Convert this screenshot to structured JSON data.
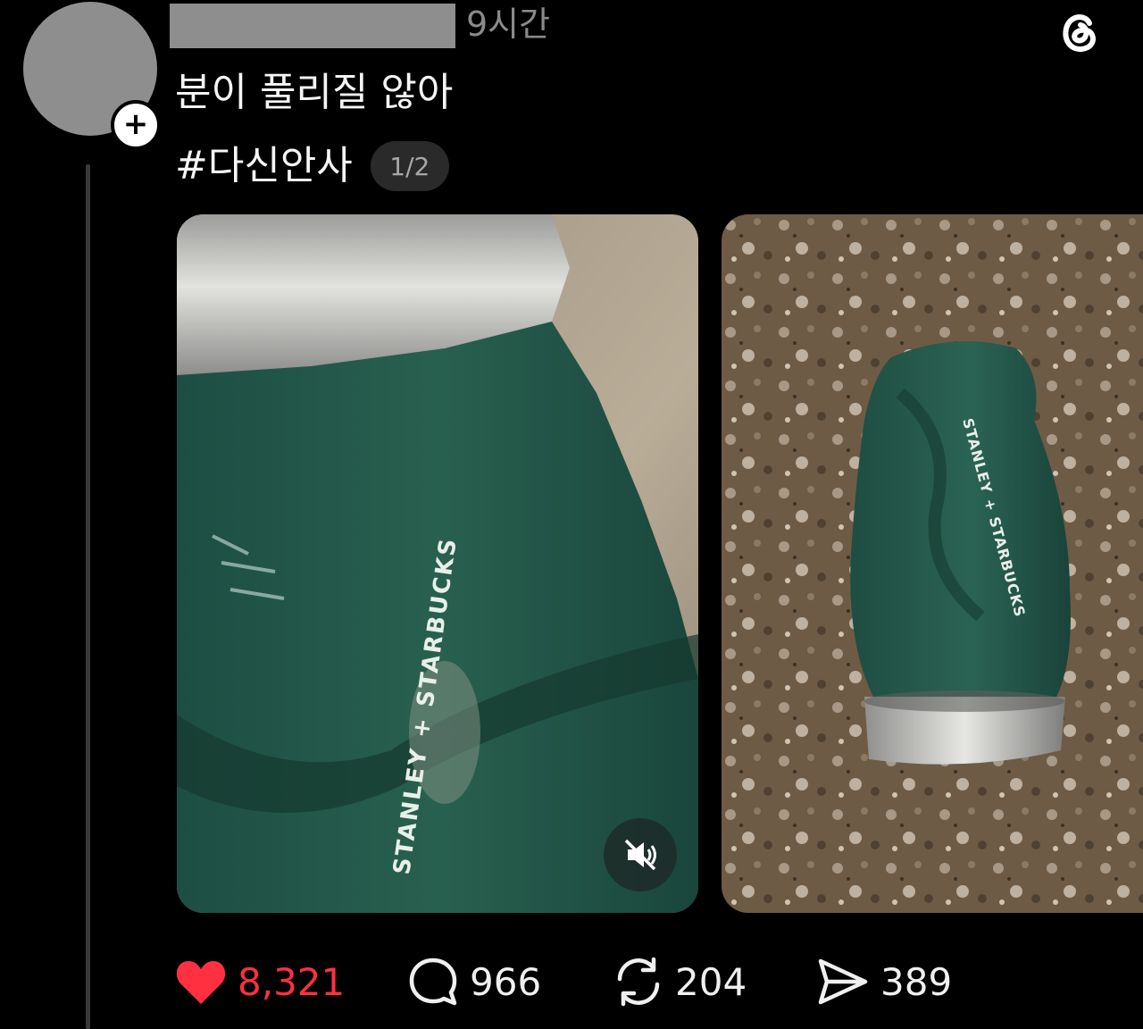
{
  "post": {
    "timestamp": "9시간",
    "text": "분이 풀리질 않아",
    "hashtag": "#다신안사",
    "media_counter": "1/2"
  },
  "actions": {
    "likes": "8,321",
    "comments": "966",
    "reposts": "204",
    "shares": "389"
  },
  "icons": {
    "app_logo": "threads-logo-icon",
    "follow": "plus-icon",
    "mute": "speaker-muted-icon",
    "like": "heart-icon",
    "comment": "comment-bubble-icon",
    "repost": "repost-icon",
    "share": "send-icon"
  },
  "colors": {
    "background": "#000000",
    "like_active": "#ff3040",
    "text": "#f5f5f5",
    "muted_text": "#8a8a8a"
  }
}
